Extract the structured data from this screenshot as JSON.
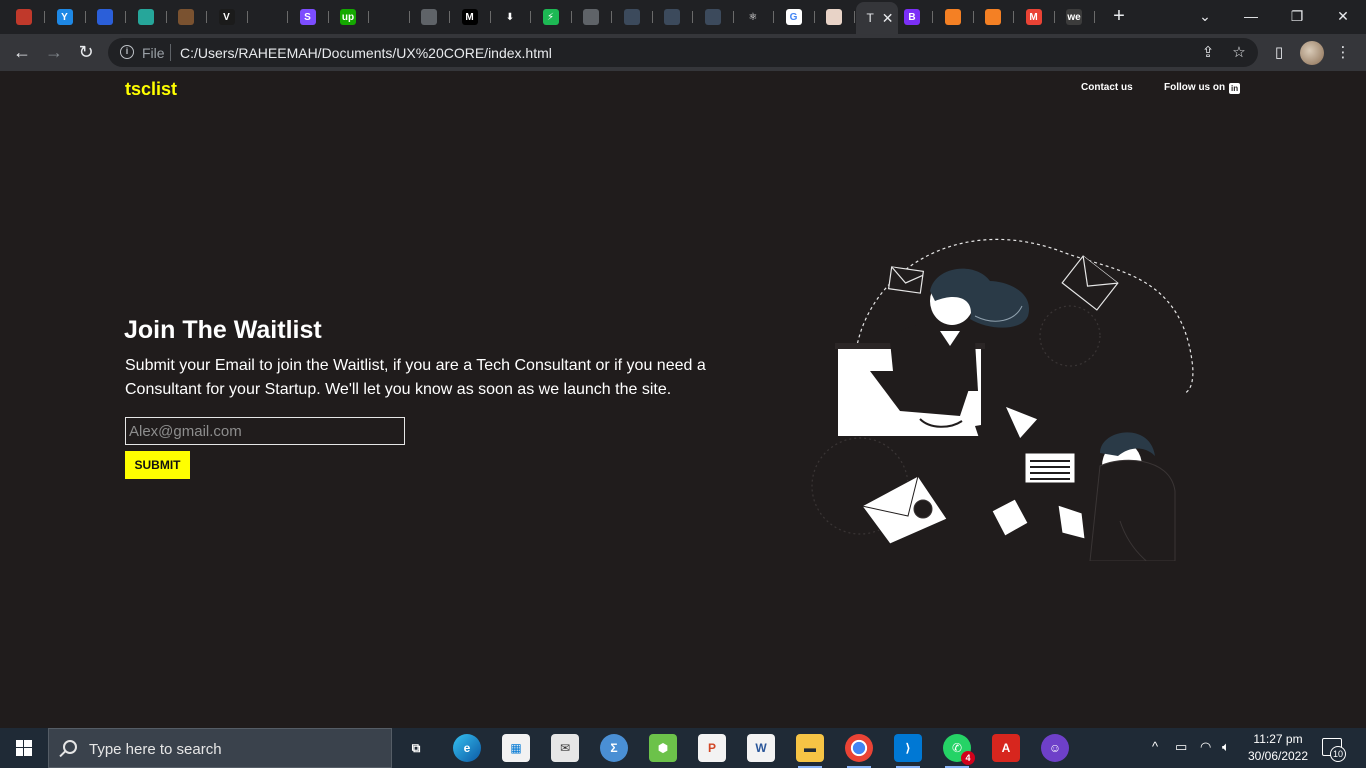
{
  "browser": {
    "tab_favicons": [
      {
        "icon": "netflix-like-icon",
        "color": "#c0392b",
        "glyph": ""
      },
      {
        "icon": "yandex-icon",
        "color": "#1e88e5",
        "glyph": "Y"
      },
      {
        "icon": "azure-icon",
        "color": "#2b5fd9",
        "glyph": ""
      },
      {
        "icon": "tag-icon",
        "color": "#26a69a",
        "glyph": ""
      },
      {
        "icon": "book-icon",
        "color": "#7a5230",
        "glyph": ""
      },
      {
        "icon": "vue-icon",
        "color": "#1b1b1b",
        "glyph": "V"
      },
      {
        "icon": "loading-icon",
        "color": "#202124",
        "glyph": ""
      },
      {
        "icon": "stripe-icon",
        "color": "#7c4dff",
        "glyph": "S"
      },
      {
        "icon": "upwork-icon",
        "color": "#14a800",
        "glyph": "up"
      },
      {
        "icon": "github-icon",
        "color": "#202124",
        "glyph": ""
      },
      {
        "icon": "globe-icon",
        "color": "#5f6368",
        "glyph": ""
      },
      {
        "icon": "medium-icon",
        "color": "#000000",
        "glyph": "M"
      },
      {
        "icon": "download-icon",
        "color": "#202124",
        "glyph": "⬇"
      },
      {
        "icon": "bolt-icon",
        "color": "#1db954",
        "glyph": "⚡"
      },
      {
        "icon": "globe-icon",
        "color": "#5f6368",
        "glyph": ""
      },
      {
        "icon": "doc-icon",
        "color": "#3c4a5c",
        "glyph": ""
      },
      {
        "icon": "doc-icon",
        "color": "#3c4a5c",
        "glyph": ""
      },
      {
        "icon": "doc-icon",
        "color": "#3c4a5c",
        "glyph": ""
      },
      {
        "icon": "react-icon",
        "color": "#202124",
        "glyph": "⚛"
      },
      {
        "icon": "google-icon",
        "color": "#ffffff",
        "glyph": "G"
      },
      {
        "icon": "image-icon",
        "color": "#e8d3c7",
        "glyph": ""
      }
    ],
    "active_tab": {
      "title": "T"
    },
    "right_tab_favicons": [
      {
        "icon": "bootstrap-icon",
        "color": "#7b2ff7",
        "glyph": "B"
      },
      {
        "icon": "stackoverflow-icon",
        "color": "#f48024",
        "glyph": ""
      },
      {
        "icon": "stackoverflow-icon",
        "color": "#f48024",
        "glyph": ""
      },
      {
        "icon": "gmail-icon",
        "color": "#ea4335",
        "glyph": "M"
      },
      {
        "icon": "we-icon",
        "color": "#3c3c3c",
        "glyph": "we"
      }
    ],
    "address": {
      "scheme_label": "File",
      "url": "C:/Users/RAHEEMAH/Documents/UX%20CORE/index.html"
    }
  },
  "site": {
    "logo": "tsclist",
    "nav": {
      "contact": "Contact us",
      "follow": "Follow us on",
      "linkedin_glyph": "in"
    },
    "hero": {
      "title": "Join The Waitlist",
      "description": "Submit your Email to join the Waitlist, if you are a Tech Consultant or if you need a Consultant for your Startup. We'll let you know as soon as we launch the site.",
      "email_placeholder": "Alex@gmail.com",
      "submit_label": "SUBMIT"
    },
    "colors": {
      "accent": "#ffff00",
      "background": "#201c1c",
      "text": "#ffffff"
    }
  },
  "taskbar": {
    "search_placeholder": "Type here to search",
    "whatsapp_badge": "4",
    "clock_time": "11:27 pm",
    "clock_date": "30/06/2022",
    "notification_count": "10"
  }
}
